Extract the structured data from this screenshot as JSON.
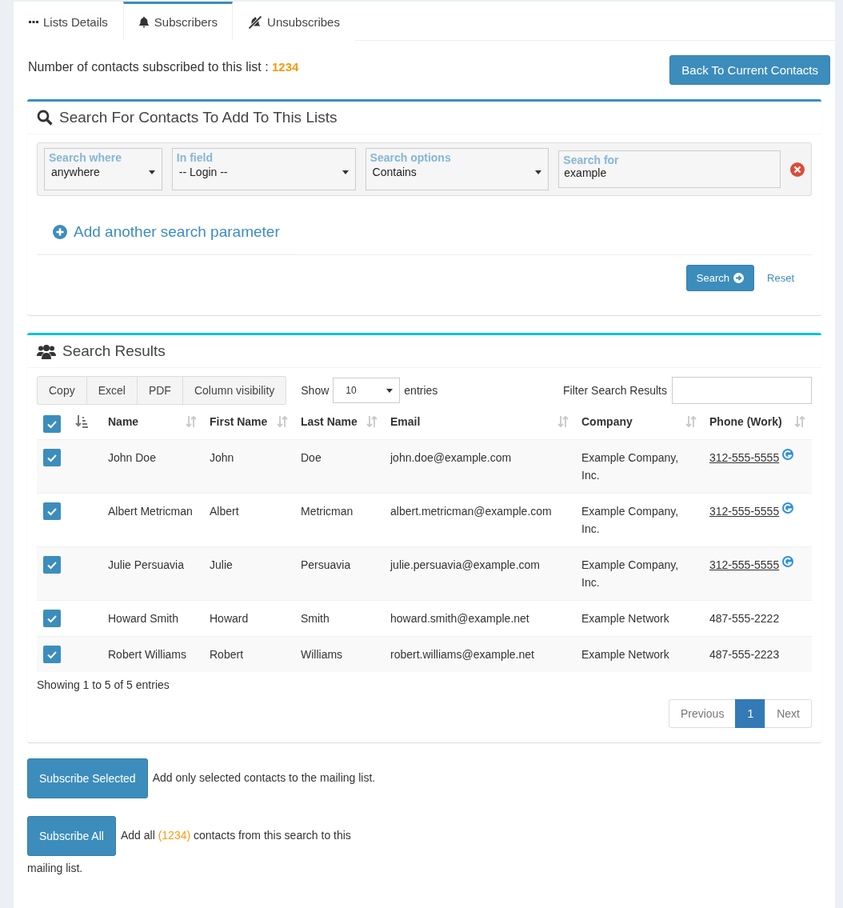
{
  "tabs": [
    {
      "label": "Lists Details",
      "selected": false
    },
    {
      "label": "Subscribers",
      "selected": true
    },
    {
      "label": "Unsubscribes",
      "selected": false
    }
  ],
  "summary": {
    "label": "Number of contacts subscribed to this list :",
    "count": "1234"
  },
  "back_button": "Back To Current Contacts",
  "search_panel": {
    "title": "Search For Contacts To Add To This Lists",
    "filters": [
      {
        "kind": "select",
        "label": "Search where",
        "value": "anywhere"
      },
      {
        "kind": "select",
        "label": "In field",
        "value": "-- Login --"
      },
      {
        "kind": "select",
        "label": "Search options",
        "value": "Contains"
      },
      {
        "kind": "text",
        "label": "Search for",
        "value": "example"
      }
    ],
    "add_parameter": "Add another search parameter",
    "search_button": "Search",
    "reset_link": "Reset"
  },
  "results": {
    "title": "Search Results",
    "export_buttons": [
      "Copy",
      "Excel",
      "PDF",
      "Column visibility"
    ],
    "length": {
      "before": "Show",
      "value": "10",
      "after": "entries"
    },
    "filter_label": "Filter Search Results",
    "select_all_checked": true,
    "columns": [
      "Name",
      "First Name",
      "Last Name",
      "Email",
      "Company",
      "Phone (Work)"
    ],
    "rows": [
      {
        "checked": true,
        "cells": [
          "John Doe",
          "John",
          "Doe",
          "john.doe@example.com",
          "Example Company, Inc.",
          "312-555-5555"
        ],
        "phone_link": true
      },
      {
        "checked": true,
        "cells": [
          "Albert Metricman",
          "Albert",
          "Metricman",
          "albert.metricman@example.com",
          "Example Company, Inc.",
          "312-555-5555"
        ],
        "phone_link": true
      },
      {
        "checked": true,
        "cells": [
          "Julie Persuavia",
          "Julie",
          "Persuavia",
          "julie.persuavia@example.com",
          "Example Company, Inc.",
          "312-555-5555"
        ],
        "phone_link": true
      },
      {
        "checked": true,
        "cells": [
          "Howard Smith",
          "Howard",
          "Smith",
          "howard.smith@example.net",
          "Example Network",
          "487-555-2222"
        ],
        "phone_link": false
      },
      {
        "checked": true,
        "cells": [
          "Robert Williams",
          "Robert",
          "Williams",
          "robert.williams@example.net",
          "Example Network",
          "487-555-2223"
        ],
        "phone_link": false
      }
    ],
    "info": "Showing 1 to 5 of 5 entries",
    "pagination": [
      {
        "label": "Previous",
        "selected": false
      },
      {
        "label": "1",
        "selected": true
      },
      {
        "label": "Next",
        "selected": false
      }
    ]
  },
  "actions": [
    {
      "button": "Subscribe Selected",
      "text": "Add only selected contacts to the mailing list."
    },
    {
      "button": "Subscribe All",
      "text_before": "Add all",
      "count": "(1234)",
      "text_after": "contacts from this search to this",
      "text_wrap": "mailing list."
    }
  ]
}
